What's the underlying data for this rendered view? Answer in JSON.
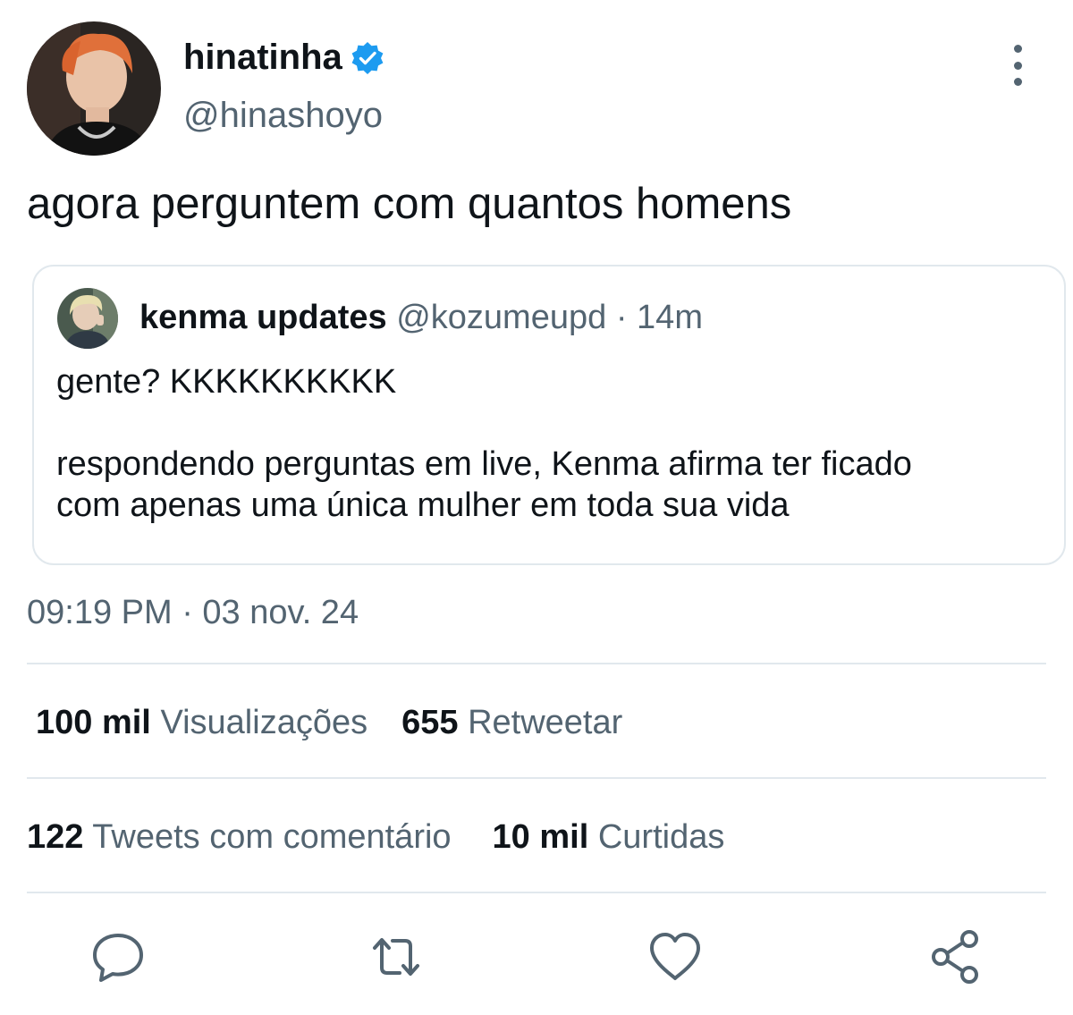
{
  "author": {
    "name": "hinatinha",
    "handle": "@hinashoyo"
  },
  "tweet": {
    "text": "agora perguntem com quantos homens",
    "timestamp": "09:19 PM · 03 nov. 24"
  },
  "quote": {
    "name": "kenma updates",
    "handle": "@kozumeupd",
    "separator": "·",
    "time": "14m",
    "line1": "gente? KKKKKKKKKK",
    "line2": "respondendo perguntas em live, Kenma afirma ter ficado",
    "line3": "com apenas uma única mulher em toda sua vida"
  },
  "stats": {
    "views_count": "100 mil",
    "views_label": "Visualizações",
    "retweets_count": "655",
    "retweets_label": "Retweetar",
    "quotes_count": "122",
    "quotes_label": "Tweets com comentário",
    "likes_count": "10 mil",
    "likes_label": "Curtidas"
  },
  "icons": {
    "more": "more-vertical-icon",
    "verified": "verified-badge-icon",
    "reply": "reply-icon",
    "retweet": "retweet-icon",
    "like": "heart-icon",
    "share": "share-icon"
  },
  "colors": {
    "verified": "#1d9bf0",
    "secondary_text": "#536471",
    "border": "#e1e8ed"
  }
}
